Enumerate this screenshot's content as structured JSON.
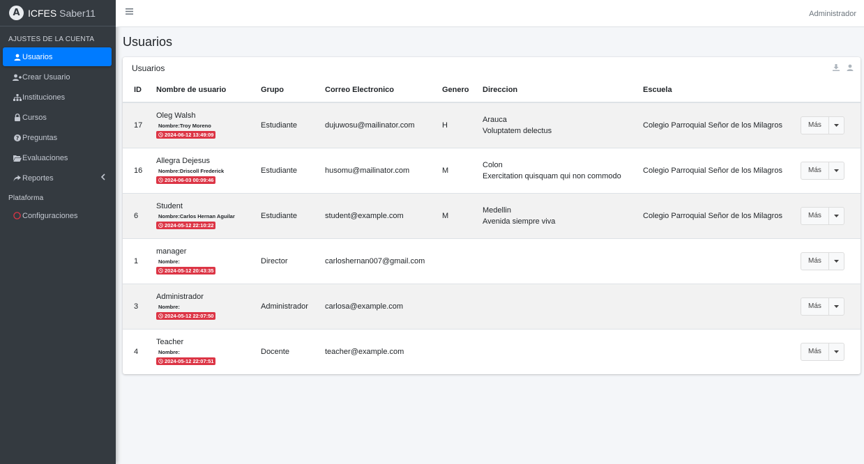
{
  "brand": {
    "name": "ICFES",
    "suffix": "Saber11",
    "logo_letter": "A"
  },
  "sidebar": {
    "section_account": "AJUSTES DE LA CUENTA",
    "items": [
      {
        "label": "Usuarios",
        "icon": "user-icon",
        "active": true
      },
      {
        "label": "Crear Usuario",
        "icon": "user-plus-icon"
      },
      {
        "label": "Instituciones",
        "icon": "sitemap-icon"
      },
      {
        "label": "Cursos",
        "icon": "lock-icon"
      },
      {
        "label": "Preguntas",
        "icon": "question-circle-icon"
      },
      {
        "label": "Evaluaciones",
        "icon": "folder-open-icon"
      },
      {
        "label": "Reportes",
        "icon": "share-icon"
      }
    ],
    "section_platform": "Plataforma",
    "platform_items": [
      {
        "label": "Configuraciones",
        "icon": "circle-outline-icon"
      }
    ]
  },
  "topbar": {
    "user": "Administrador"
  },
  "page": {
    "title": "Usuarios"
  },
  "card": {
    "title": "Usuarios"
  },
  "table": {
    "headers": [
      "ID",
      "Nombre de usuario",
      "Grupo",
      "Correo Electronico",
      "Genero",
      "Direccion",
      "Escuela"
    ],
    "action_label": "Más",
    "rows": [
      {
        "id": "17",
        "username": "Oleg Walsh",
        "fullname": "Nombre:Troy Moreno",
        "date": "2024-06-12 13:49:09",
        "grupo": "Estudiante",
        "correo": "dujuwosu@mailinator.com",
        "genero": "H",
        "dir1": "Arauca",
        "dir2": "Voluptatem delectus",
        "escuela": "Colegio Parroquial Señor de los Milagros"
      },
      {
        "id": "16",
        "username": "Allegra Dejesus",
        "fullname": "Nombre:Driscoll Frederick",
        "date": "2024-06-03 00:09:46",
        "grupo": "Estudiante",
        "correo": "husomu@mailinator.com",
        "genero": "M",
        "dir1": "Colon",
        "dir2": "Exercitation quisquam qui non commodo",
        "escuela": "Colegio Parroquial Señor de los Milagros"
      },
      {
        "id": "6",
        "username": "Student",
        "fullname": "Nombre:Carlos Hernan Aguilar",
        "date": "2024-05-12 22:10:22",
        "grupo": "Estudiante",
        "correo": "student@example.com",
        "genero": "M",
        "dir1": "Medellin",
        "dir2": "Avenida siempre viva",
        "escuela": "Colegio Parroquial Señor de los Milagros"
      },
      {
        "id": "1",
        "username": "manager",
        "fullname": "Nombre:",
        "date": "2024-05-12 20:43:35",
        "grupo": "Director",
        "correo": "carloshernan007@gmail.com",
        "genero": "",
        "dir1": "",
        "dir2": "",
        "escuela": ""
      },
      {
        "id": "3",
        "username": "Administrador",
        "fullname": "Nombre:",
        "date": "2024-05-12 22:07:50",
        "grupo": "Administrador",
        "correo": "carlosa@example.com",
        "genero": "",
        "dir1": "",
        "dir2": "",
        "escuela": ""
      },
      {
        "id": "4",
        "username": "Teacher",
        "fullname": "Nombre:",
        "date": "2024-05-12 22:07:51",
        "grupo": "Docente",
        "correo": "teacher@example.com",
        "genero": "",
        "dir1": "",
        "dir2": "",
        "escuela": ""
      }
    ]
  },
  "colors": {
    "sidebar_bg": "#343a40",
    "active": "#007bff",
    "badge": "#dc3545",
    "platform_icon": "#dc3545"
  }
}
